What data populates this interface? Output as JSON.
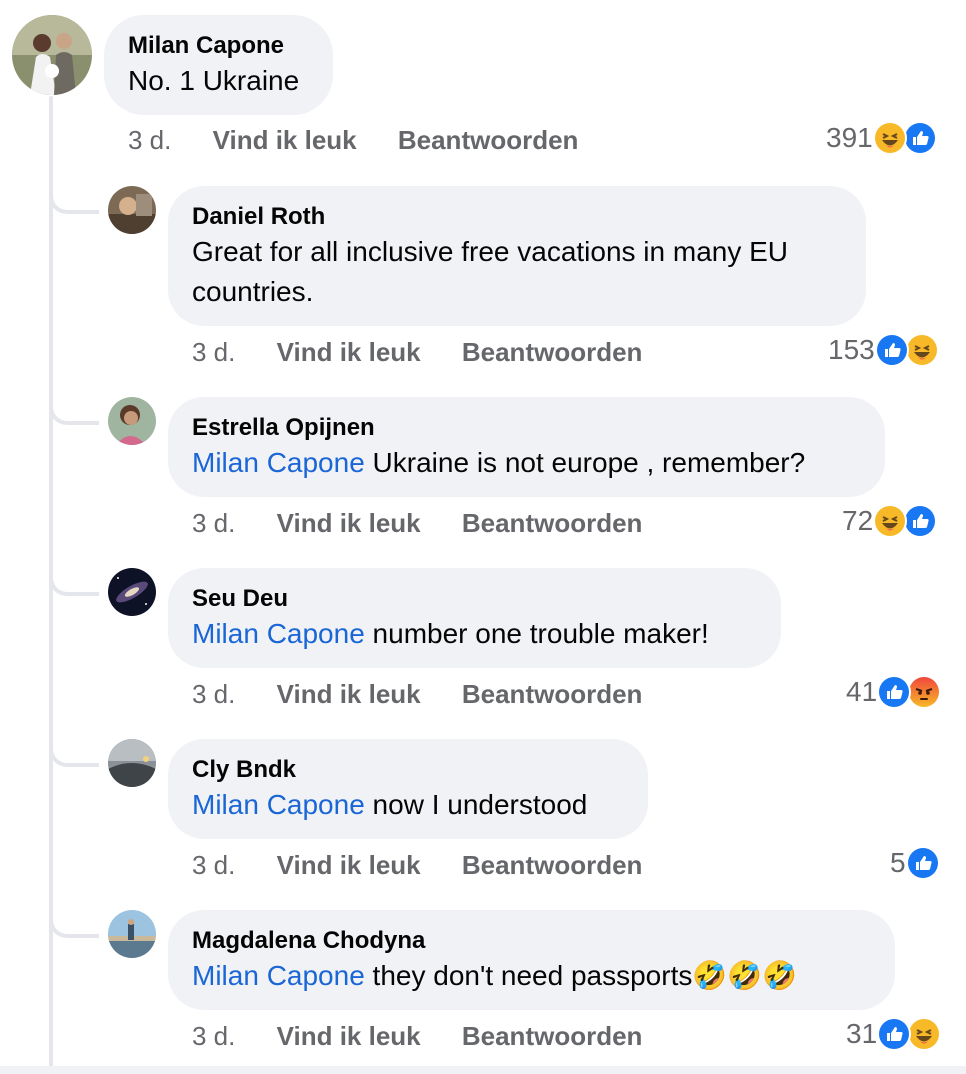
{
  "main_comment": {
    "author": "Milan Capone",
    "text": "No. 1 Ukraine",
    "time": "3 d.",
    "like_label": "Vind ik leuk",
    "reply_label": "Beantwoorden",
    "reaction_count": "391",
    "reactions": [
      "haha-icon",
      "like-icon"
    ]
  },
  "replies": [
    {
      "author": "Daniel Roth",
      "mention": "",
      "text": "Great for all inclusive free vacations in many EU",
      "text2": "countries.",
      "time": "3 d.",
      "like_label": "Vind ik leuk",
      "reply_label": "Beantwoorden",
      "reaction_count": "153",
      "reactions": [
        "like-icon",
        "haha-icon"
      ]
    },
    {
      "author": "Estrella Opijnen",
      "mention": "Milan Capone",
      "text": " Ukraine is not europe , remember?",
      "time": "3 d.",
      "like_label": "Vind ik leuk",
      "reply_label": "Beantwoorden",
      "reaction_count": "72",
      "reactions": [
        "haha-icon",
        "like-icon"
      ]
    },
    {
      "author": "Seu Deu",
      "mention": "Milan Capone",
      "text": " number one trouble maker!",
      "time": "3 d.",
      "like_label": "Vind ik leuk",
      "reply_label": "Beantwoorden",
      "reaction_count": "41",
      "reactions": [
        "like-icon",
        "angry-icon"
      ]
    },
    {
      "author": "Cly Bndk",
      "mention": "Milan Capone",
      "text": " now I understood",
      "time": "3 d.",
      "like_label": "Vind ik leuk",
      "reply_label": "Beantwoorden",
      "reaction_count": "5",
      "reactions": [
        "like-icon"
      ]
    },
    {
      "author": "Magdalena Chodyna",
      "mention": "Milan Capone",
      "text": " they don't need passports",
      "emojis": "🤣🤣🤣",
      "time": "3 d.",
      "like_label": "Vind ik leuk",
      "reply_label": "Beantwoorden",
      "reaction_count": "31",
      "reactions": [
        "like-icon",
        "haha-icon"
      ]
    }
  ],
  "colors": {
    "bubble": "#f0f2f5",
    "mention": "#1a66d6",
    "meta": "#65676b",
    "like_blue": "#1877f2",
    "haha_yellow": "#f7b928",
    "angry_red": "#e9710f"
  }
}
